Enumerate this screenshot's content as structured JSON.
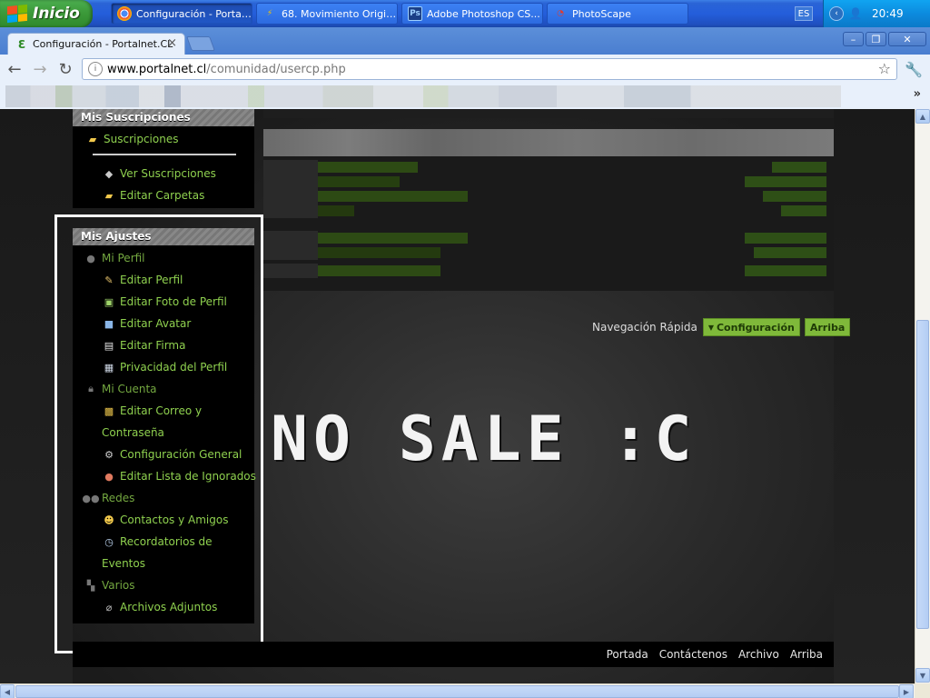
{
  "taskbar": {
    "start_label": "Inicio",
    "tasks": [
      {
        "label": "Configuración - Portal...",
        "icon": "chrome-icon",
        "active": true
      },
      {
        "label": "68. Movimiento Origin...",
        "icon": "winamp-icon",
        "active": false
      },
      {
        "label": "Adobe Photoshop CS...",
        "icon": "photoshop-icon",
        "active": false
      },
      {
        "label": "PhotoScape",
        "icon": "photoscape-icon",
        "active": false
      }
    ],
    "language": "ES",
    "clock": "20:49"
  },
  "browser": {
    "tab_title": "Configuración - Portalnet.CL",
    "url_host": "www.portalnet.cl",
    "url_path": "/comunidad/usercp.php"
  },
  "sidebar": {
    "subscriptions": {
      "header": "Mis Suscripciones",
      "folder": "Suscripciones",
      "items": [
        "Ver Suscripciones",
        "Editar Carpetas"
      ]
    },
    "settings": {
      "header": "Mis Ajustes",
      "profile_cat": "Mi Perfil",
      "profile_items": [
        "Editar Perfil",
        "Editar Foto de Perfil",
        "Editar Avatar",
        "Editar Firma",
        "Privacidad del Perfil"
      ],
      "account_cat": "Mi Cuenta",
      "account_email_1": "Editar Correo y",
      "account_email_2": "Contraseña",
      "account_items": [
        "Configuración General",
        "Editar Lista de Ignorados"
      ],
      "networks_cat": "Redes",
      "contacts": "Contactos y Amigos",
      "reminders_1": "Recordatorios de",
      "reminders_2": "Eventos",
      "misc_cat": "Varios",
      "attachments": "Archivos Adjuntos"
    }
  },
  "quicknav": {
    "label": "Navegación Rápida",
    "config": "Configuración",
    "top": "Arriba"
  },
  "message": "NO SALE :C",
  "footer": {
    "links": [
      "Portada",
      "Contáctenos",
      "Archivo",
      "Arriba"
    ]
  },
  "colors": {
    "link_green": "#8fd14f",
    "category_green": "#74a840",
    "button_green": "#7fb93a"
  }
}
